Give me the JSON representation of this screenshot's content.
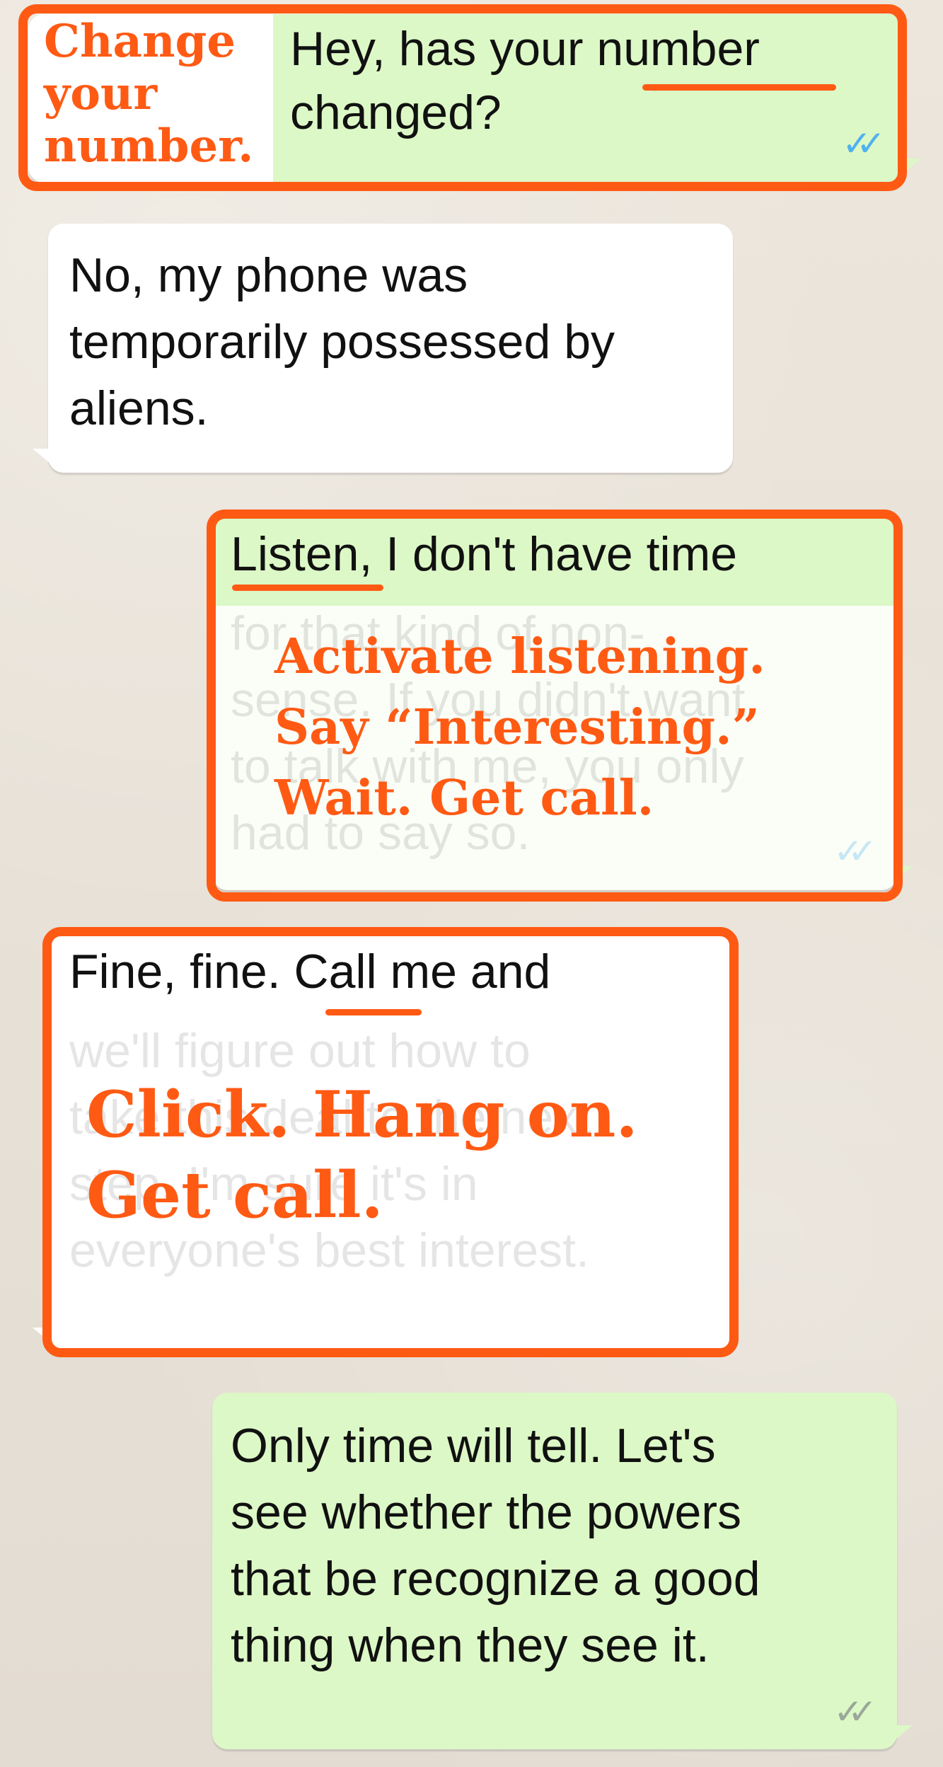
{
  "messages": {
    "m1": {
      "annotation": [
        "Change",
        "your",
        "number."
      ],
      "line1_before": "Hey, has your ",
      "line1_word": "number",
      "line2": "changed?",
      "ticks": "✓✓"
    },
    "m2": {
      "lines": [
        "No, my phone was",
        "temporarily possessed by",
        "aliens."
      ]
    },
    "m3": {
      "word": "Listen",
      "rest": ", I don't have time",
      "faded": [
        "for that kind of non-",
        "sense. If you didn't want",
        "to talk with me, you only",
        "had to say so."
      ],
      "annotation": [
        "Activate listening.",
        "Say “Interesting.”",
        "Wait. Get call."
      ],
      "ticks": "✓✓"
    },
    "m4": {
      "before": "Fine, fine. ",
      "word": "Call",
      "after": " me and",
      "faded": [
        "we'll figure out how to",
        "take this deal to the next",
        "step. I'm sure it's in",
        "everyone's best interest."
      ],
      "annotation": [
        "Click. Hang on.",
        "Get call."
      ]
    },
    "m5": {
      "lines": [
        "Only time will tell. Let's",
        "see whether the powers",
        "that be recognize a good",
        "thing when they see it."
      ],
      "ticks": "✓✓"
    }
  },
  "colors": {
    "accent": "#ff5a14",
    "outgoing": "#dcf8c6",
    "incoming": "#ffffff",
    "read_ticks": "#4fb1f0",
    "sent_ticks": "#9aa79a"
  }
}
